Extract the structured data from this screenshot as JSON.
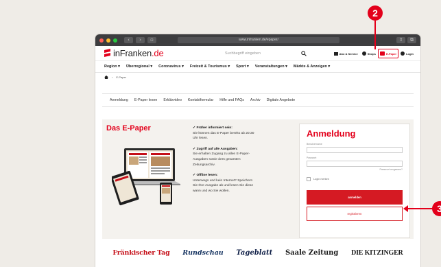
{
  "browser": {
    "url": "www.infranken.de/epaper/"
  },
  "header": {
    "logo_main": "inFranken",
    "logo_suffix": ".de",
    "search_placeholder": "Suchbegriff eingeben",
    "links": [
      "Abo & Service",
      "Shops",
      "E-Paper",
      "Login"
    ]
  },
  "nav": {
    "items": [
      "Region ▾",
      "Überregional ▾",
      "Coronavirus ▾",
      "Freizeit & Tourismus ▾",
      "Sport ▾",
      "Veranstaltungen ▾",
      "Märkte & Anzeigen ▾"
    ]
  },
  "breadcrumb": {
    "current": "E-Paper"
  },
  "tabs": [
    "Anmeldung",
    "E-Paper lesen",
    "Erklärvideo",
    "Kontaktformular",
    "Hilfe und FAQs",
    "Archiv",
    "Digitale Angebote"
  ],
  "epaper": {
    "title": "Das E-Paper",
    "features": [
      {
        "title": "✓ Früher informiert sein:",
        "text": "Sie können das E-Paper bereits ab 20:30 Uhr lesen."
      },
      {
        "title": "✓ Zugriff auf alle Ausgaben:",
        "text": "Sie erhalten Zugang zu allen E-Paper-Ausgaben sowie dem gesamten Zeitungsarchiv."
      },
      {
        "title": "✓ Offline lesen:",
        "text": "Unterwegs und kein Internet? Speichern Sie Ihre Ausgabe ab und lesen Sie diese wann und wo Sie wollen."
      }
    ]
  },
  "login": {
    "title": "Anmeldung",
    "username_label": "Benutzername",
    "password_label": "Passwort",
    "forgot": "Passwort vergessen?",
    "remember": "Login merken",
    "login_button": "anmelden",
    "register_button": "registrieren"
  },
  "newspapers": [
    "Fränkischer Tag",
    "Rundschau",
    "Tageblatt",
    "Saale Zeitung",
    "DIE KITZINGER"
  ],
  "annotations": {
    "badge_top": "2",
    "badge_side": "3"
  },
  "colors": {
    "accent": "#e3001b",
    "button": "#d51a23",
    "page_bg": "#efece7"
  }
}
